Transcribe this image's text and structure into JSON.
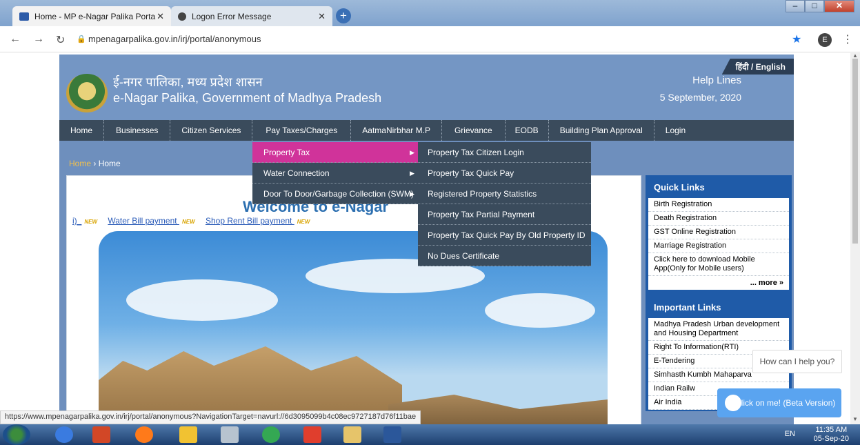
{
  "browser": {
    "tabs": [
      {
        "title": "Home - MP e-Nagar Palika Porta"
      },
      {
        "title": "Logon Error Message"
      }
    ],
    "url": "mpenagarpalika.gov.in/irj/portal/anonymous",
    "profile_letter": "E",
    "status_url": "https://www.mpenagarpalika.gov.in/irj/portal/anonymous?NavigationTarget=navurl://6d3095099b4c08ec9727187d76f11bae"
  },
  "header": {
    "lang_switch": "हिंदी / English",
    "title_hi": "ई-नगर पालिका, मध्य प्रदेश शासन",
    "title_en": "e-Nagar Palika, Government of Madhya Pradesh",
    "help": "Help Lines",
    "date": "5 September, 2020"
  },
  "menu": [
    "Home",
    "Businesses",
    "Citizen Services",
    "Pay Taxes/Charges",
    "AatmaNirbhar M.P",
    "Grievance",
    "EODB",
    "Building Plan Approval",
    "Login"
  ],
  "breadcrumb": {
    "first": "Home",
    "sep": "›",
    "current": "Home"
  },
  "submenu": [
    "Property Tax",
    "Water Connection",
    "Door To Door/Garbage Collection (SWM)"
  ],
  "submenu2": [
    "Property Tax Citizen Login",
    "Property Tax Quick Pay",
    "Registered Property Statistics",
    "Property Tax Partial Payment",
    "Property Tax Quick Pay By Old Property ID",
    "No Dues Certificate"
  ],
  "main": {
    "welcome": "Welcome to e-Nagar",
    "links": [
      {
        "label": "i)_",
        "badge": "NEW"
      },
      {
        "label": "Water Bill payment ",
        "badge": "NEW"
      },
      {
        "label": "Shop Rent Bill payment ",
        "badge": "NEW"
      }
    ]
  },
  "quick_links": {
    "title": "Quick Links",
    "items": [
      "Birth Registration",
      "Death Registration",
      "GST Online Registration",
      "Marriage Registration",
      "Click here to download Mobile App(Only for Mobile users)"
    ],
    "more": "... more »"
  },
  "important_links": {
    "title": "Important Links",
    "items": [
      "Madhya Pradesh Urban development and Housing Department",
      "Right To Information(RTI)",
      "E-Tendering",
      "Simhasth Kumbh Mahaparva",
      "Indian Railw",
      "Air India"
    ]
  },
  "chat": {
    "bubble": "How can I help you?",
    "button": "Click on me! (Beta Version)"
  },
  "taskbar": {
    "lang": "EN",
    "time": "11:35 AM",
    "date": "05-Sep-20"
  },
  "colors": {
    "header": "#7496c4",
    "menu": "#3a4b5c",
    "selected": "#d0339a",
    "panel": "#1f5ba8"
  }
}
